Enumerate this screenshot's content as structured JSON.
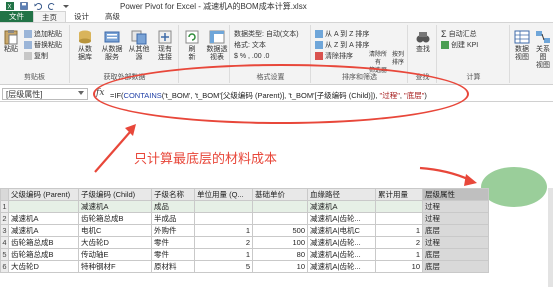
{
  "window": {
    "title": "Power Pivot for Excel - 减速机A的BOM成本计算.xlsx"
  },
  "tabs": [
    {
      "label": "文件"
    },
    {
      "label": "主页"
    },
    {
      "label": "设计"
    },
    {
      "label": "高级"
    }
  ],
  "ribbon": {
    "clipboard": {
      "label": "剪贴板",
      "paste": "粘贴",
      "paste_append": "追加粘贴",
      "paste_replace": "替换粘贴",
      "copy": "复制"
    },
    "get_data": {
      "label": "获取外部数据",
      "from_db": "从数\n据库",
      "from_service": "从数据\n服务",
      "from_other": "从其他\n源",
      "existing": "现有\n连接"
    },
    "refresh": {
      "label": "刷\n新"
    },
    "pivot": {
      "label": "数据透\n视表"
    },
    "formatting": {
      "label": "格式设置",
      "data_type": "数据类型: 自动(文本)",
      "format": "格式: 文本",
      "currency": "$ % , .00 .0"
    },
    "sort_filter": {
      "label": "排序和筛选",
      "sort_asc": "从 A 到 Z 排序",
      "sort_desc": "从 Z 到 A 排序",
      "clear_sort": "清除排序",
      "clear_filter": "清除所有\n筛选器",
      "sort_by_col": "按列\n排序"
    },
    "find": {
      "label": "查找",
      "find": "查找"
    },
    "calc": {
      "label": "计算",
      "autosum": "自动汇总",
      "create_kpi": "创建 KPI"
    },
    "view": {
      "label": "查看",
      "data_view": "数据\n视图",
      "diagram": "关系图\n视图"
    }
  },
  "formula_bar": {
    "name_box": "[层级属性]",
    "fx": "fx",
    "formula_prefix": "=IF(",
    "formula_fn": "CONTAINS",
    "formula_mid": "('t_BOM', 't_BOM'[父级编码 (Parent)], 't_BOM'[子级编码 (Child)]), ",
    "formula_str1": "\"过程\"",
    "formula_sep": ", ",
    "formula_str2": "\"底层\"",
    "formula_end": ")"
  },
  "annotation": {
    "note": "只计算最底层的材料成本"
  },
  "table": {
    "headers": [
      "父级编码 (Parent)",
      "子级编码 (Child)",
      "子级名称",
      "单位用量 (Q...",
      "基础单价",
      "血缘路径",
      "累计用量",
      "层级属性"
    ],
    "rows": [
      {
        "num": "1",
        "cells": [
          "",
          "减速机A",
          "成品",
          "",
          "",
          "减速机A",
          "",
          "过程"
        ]
      },
      {
        "num": "2",
        "cells": [
          "减速机A",
          "齿轮箱总成B",
          "半成品",
          "",
          "",
          "减速机A|齿轮...",
          "",
          "过程"
        ]
      },
      {
        "num": "3",
        "cells": [
          "减速机A",
          "电机C",
          "外购件",
          "1",
          "500",
          "减速机A|电机C",
          "1",
          "底层"
        ]
      },
      {
        "num": "4",
        "cells": [
          "齿轮箱总成B",
          "大齿轮D",
          "零件",
          "2",
          "100",
          "减速机A|齿轮...",
          "2",
          "过程"
        ]
      },
      {
        "num": "5",
        "cells": [
          "齿轮箱总成B",
          "传动轴E",
          "零件",
          "1",
          "80",
          "减速机A|齿轮...",
          "1",
          "底层"
        ]
      },
      {
        "num": "6",
        "cells": [
          "大齿轮D",
          "特种钢材F",
          "原材料",
          "5",
          "10",
          "减速机A|齿轮...",
          "10",
          "底层"
        ]
      }
    ]
  },
  "colors": {
    "file_tab": "#217346",
    "annotation": "#e8473a",
    "highlight": "#78be78"
  }
}
